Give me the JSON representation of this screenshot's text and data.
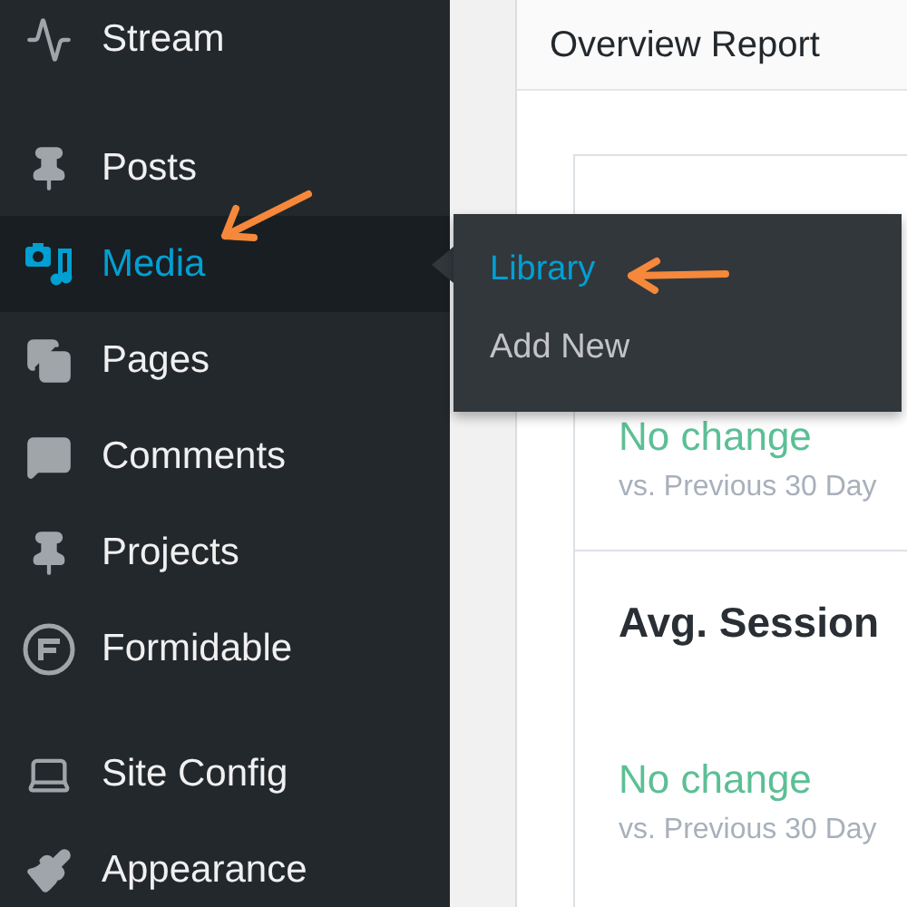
{
  "sidebar": {
    "groups": [
      [
        {
          "label": "Stream",
          "selected": false
        }
      ],
      [
        {
          "label": "Posts",
          "selected": false
        },
        {
          "label": "Media",
          "selected": true
        },
        {
          "label": "Pages",
          "selected": false
        },
        {
          "label": "Comments",
          "selected": false
        },
        {
          "label": "Projects",
          "selected": false
        },
        {
          "label": "Formidable",
          "selected": false
        }
      ],
      [
        {
          "label": "Site Config",
          "selected": false
        },
        {
          "label": "Appearance",
          "selected": false
        }
      ]
    ]
  },
  "flyout": {
    "items": [
      {
        "label": "Library",
        "selected": true
      },
      {
        "label": "Add New",
        "selected": false
      }
    ]
  },
  "panel": {
    "title": "Overview Report",
    "sections": [
      {
        "change": "No change",
        "comparison": "vs. Previous 30 Day"
      },
      {
        "title": "Avg. Session",
        "change": "No change",
        "comparison": "vs. Previous 30 Day"
      }
    ]
  }
}
